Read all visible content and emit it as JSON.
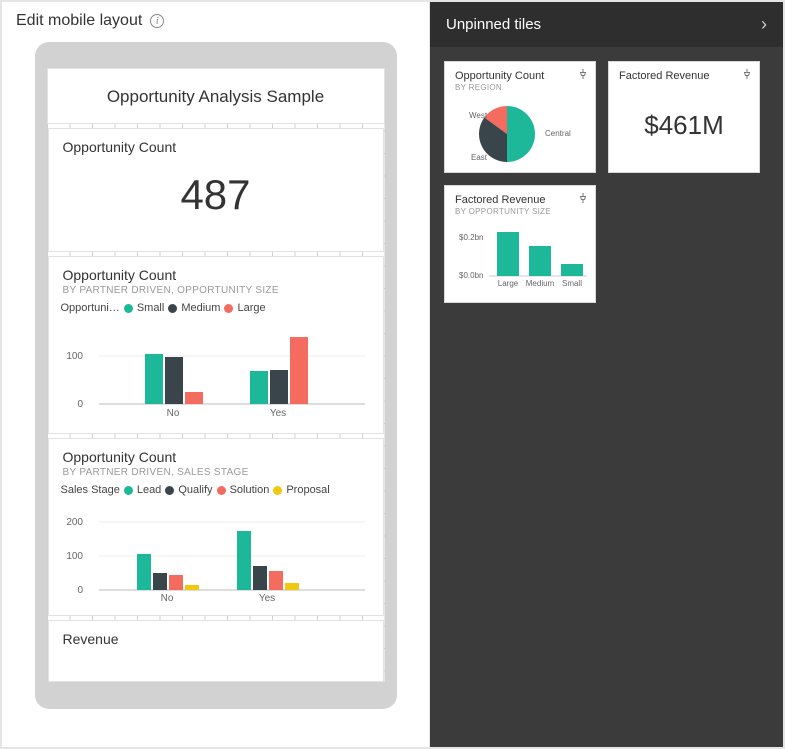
{
  "colors": {
    "teal": "#1db79a",
    "dark": "#3a454b",
    "coral": "#f46b5f",
    "yellow": "#f2c80f"
  },
  "header": {
    "title": "Edit mobile layout"
  },
  "phone": {
    "title": "Opportunity Analysis Sample",
    "tiles": {
      "count": {
        "title": "Opportunity Count",
        "value": "487"
      },
      "byPartnerSize": {
        "title": "Opportunity Count",
        "subtitle": "BY PARTNER DRIVEN, OPPORTUNITY SIZE",
        "legendLabel": "Opportuni…",
        "legend": [
          "Small",
          "Medium",
          "Large"
        ]
      },
      "byPartnerStage": {
        "title": "Opportunity Count",
        "subtitle": "BY PARTNER DRIVEN, SALES STAGE",
        "legendLabel": "Sales Stage",
        "legend": [
          "Lead",
          "Qualify",
          "Solution",
          "Proposal"
        ]
      },
      "revenue": {
        "title": "Revenue"
      }
    }
  },
  "unpinned": {
    "header": "Unpinned tiles",
    "tiles": {
      "pie": {
        "title": "Opportunity Count",
        "subtitle": "BY REGION",
        "labels": [
          "West",
          "Central",
          "East"
        ]
      },
      "factoredBig": {
        "title": "Factored Revenue",
        "value": "$461M"
      },
      "factoredBar": {
        "title": "Factored Revenue",
        "subtitle": "BY OPPORTUNITY SIZE",
        "yticks": [
          "$0.2bn",
          "$0.0bn"
        ],
        "cats": [
          "Large",
          "Medium",
          "Small"
        ]
      }
    }
  },
  "chart_data": [
    {
      "type": "bar",
      "title": "Opportunity Count by Partner Driven, Opportunity Size",
      "categories": [
        "No",
        "Yes"
      ],
      "ylabel": "",
      "ylim": [
        0,
        150
      ],
      "yticks": [
        0,
        100
      ],
      "series": [
        {
          "name": "Small",
          "color": "#1db79a",
          "values": [
            105,
            70
          ]
        },
        {
          "name": "Medium",
          "color": "#3a454b",
          "values": [
            98,
            72
          ]
        },
        {
          "name": "Large",
          "color": "#f46b5f",
          "values": [
            25,
            140
          ]
        }
      ]
    },
    {
      "type": "bar",
      "title": "Opportunity Count by Partner Driven, Sales Stage",
      "categories": [
        "No",
        "Yes"
      ],
      "ylabel": "",
      "ylim": [
        0,
        200
      ],
      "yticks": [
        0,
        100,
        200
      ],
      "series": [
        {
          "name": "Lead",
          "color": "#1db79a",
          "values": [
            107,
            175
          ]
        },
        {
          "name": "Qualify",
          "color": "#3a454b",
          "values": [
            50,
            70
          ]
        },
        {
          "name": "Solution",
          "color": "#f46b5f",
          "values": [
            45,
            55
          ]
        },
        {
          "name": "Proposal",
          "color": "#f2c80f",
          "values": [
            15,
            20
          ]
        }
      ]
    },
    {
      "type": "pie",
      "title": "Opportunity Count by Region",
      "categories": [
        "West",
        "Central",
        "East"
      ],
      "values": [
        15,
        50,
        35
      ],
      "colors": [
        "#f46b5f",
        "#1db79a",
        "#3a454b"
      ]
    },
    {
      "type": "bar",
      "title": "Factored Revenue by Opportunity Size",
      "categories": [
        "Large",
        "Medium",
        "Small"
      ],
      "ylabel": "",
      "ylim": [
        0,
        0.25
      ],
      "yticks": [
        0.0,
        0.2
      ],
      "series": [
        {
          "name": "Factored Revenue",
          "color": "#1db79a",
          "values": [
            0.22,
            0.15,
            0.06
          ]
        }
      ]
    }
  ]
}
